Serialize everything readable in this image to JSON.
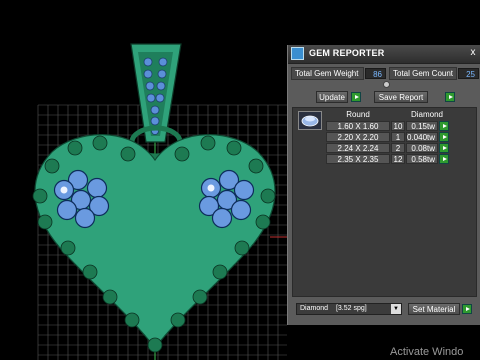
{
  "reporter": {
    "title": "GEM REPORTER",
    "close_label": "x",
    "total_gem_weight_label": "Total Gem Weight",
    "total_gem_weight_value": "86",
    "total_gem_count_label": "Total Gem Count",
    "total_gem_count_value": "25",
    "update_label": "Update",
    "save_report_label": "Save Report",
    "columns": [
      "Round",
      "Diamond"
    ],
    "rows": [
      {
        "size": "1.60 X 1.60",
        "count": "10",
        "weight": "0.15tw"
      },
      {
        "size": "2.20 X 2.20",
        "count": "1",
        "weight": "0.040tw"
      },
      {
        "size": "2.24 X 2.24",
        "count": "2",
        "weight": "0.08tw"
      },
      {
        "size": "2.35 X 2.35",
        "count": "12",
        "weight": "0.58tw"
      }
    ],
    "material_value": "Diamond",
    "material_spg": "[3.52 spg]",
    "set_material_label": "Set Material"
  },
  "watermark": "Activate Windo",
  "colors": {
    "pendant": "#2fa27a",
    "bead": "#1d7a52",
    "gem": "#4a7ac8",
    "panel": "#5b5b5b",
    "accent_blue": "#7ab8ff",
    "green_button": "#2f9a2f"
  }
}
